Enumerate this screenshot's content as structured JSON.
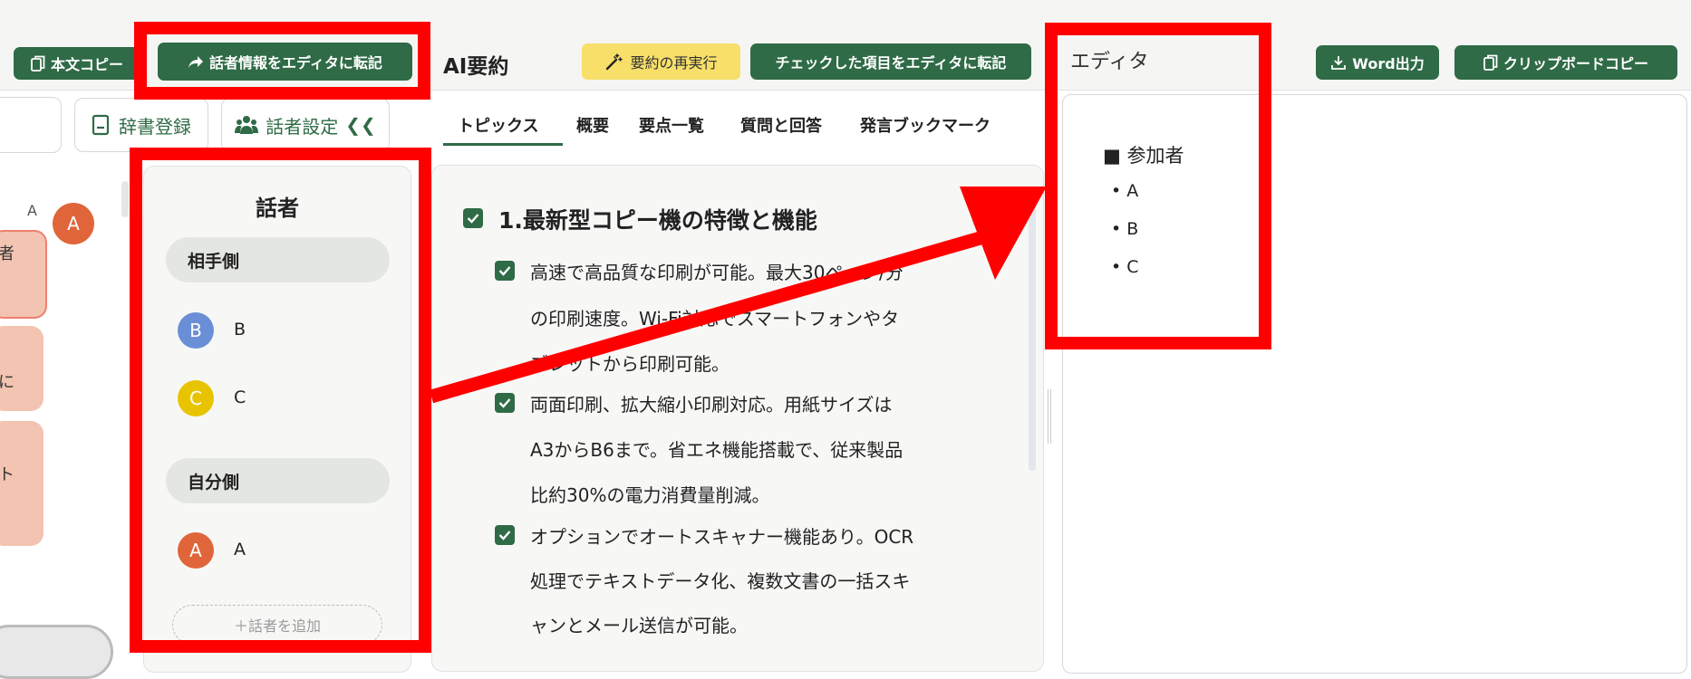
{
  "toolbar": {
    "copy_body": "本文コピー",
    "transfer_speaker": "話者情報をエディタに転記",
    "ai_summary": "AI要約",
    "rerun_summary": "要約の再実行",
    "transfer_checked": "チェックした項目をエディタに転記",
    "editor_title": "エディタ",
    "word_export": "Word出力",
    "clipboard_copy": "クリップボードコピー"
  },
  "subtoolbar": {
    "dictionary": "辞書登録",
    "speaker_settings": "話者設定",
    "collapse": "❮❮"
  },
  "tabs": [
    "トピックス",
    "概要",
    "要点一覧",
    "質問と回答",
    "発言ブックマーク"
  ],
  "speakers_panel": {
    "title": "話者",
    "other_side": "相手側",
    "own_side": "自分側",
    "add_speaker": "＋話者を追加",
    "others": [
      {
        "initial": "B",
        "name": "B",
        "color": "#6b8fd6"
      },
      {
        "initial": "C",
        "name": "C",
        "color": "#e8c400"
      }
    ],
    "own": [
      {
        "initial": "A",
        "name": "A",
        "color": "#e0653a"
      }
    ]
  },
  "left_transcript": {
    "speaker_label": "A",
    "speaker_initial": "A",
    "speaker_color": "#e0653a",
    "snippets": [
      "者",
      "に",
      "ト"
    ]
  },
  "topics": {
    "heading": "1.最新型コピー機の特徴と機能",
    "items": [
      {
        "lines": [
          "高速で高品質な印刷が可能。最大30ページ/分",
          "の印刷速度。Wi-Fi対応でスマートフォンやタ",
          "ブレットから印刷可能。"
        ]
      },
      {
        "lines": [
          "両面印刷、拡大縮小印刷対応。用紙サイズは",
          "A3からB6まで。省エネ機能搭載で、従来製品",
          "比約30%の電力消費量削減。"
        ]
      },
      {
        "lines": [
          "オプションでオートスキャナー機能あり。OCR",
          "処理でテキストデータ化、複数文書の一括スキ",
          "ャンとメール送信が可能。"
        ]
      }
    ]
  },
  "editor": {
    "heading": "■ 参加者",
    "bullets": [
      "• A",
      "• B",
      "• C"
    ]
  },
  "colors": {
    "accent_green": "#2f6b46",
    "highlight_red": "#ff0000",
    "rerun_yellow": "#f7df6a"
  }
}
